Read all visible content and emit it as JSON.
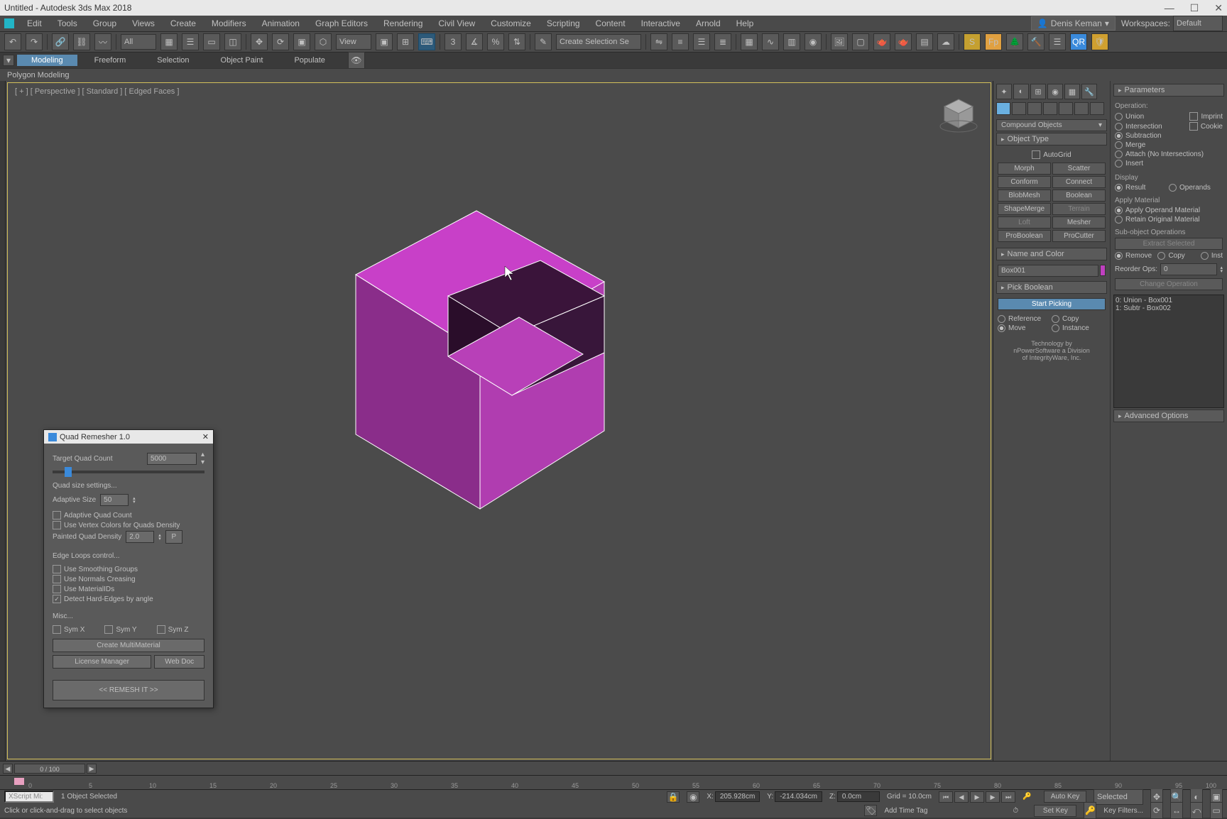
{
  "app": {
    "title": "Untitled - Autodesk 3ds Max 2018"
  },
  "menu": {
    "items": [
      "Edit",
      "Tools",
      "Group",
      "Views",
      "Create",
      "Modifiers",
      "Animation",
      "Graph Editors",
      "Rendering",
      "Civil View",
      "Customize",
      "Scripting",
      "Content",
      "Interactive",
      "Arnold",
      "Help"
    ],
    "user": "Denis Keman",
    "workspaces_label": "Workspaces:",
    "workspaces_value": "Default"
  },
  "toolbar": {
    "filter": "All",
    "view": "View",
    "selset": "Create Selection Se"
  },
  "ribbon": {
    "tabs": [
      "Modeling",
      "Freeform",
      "Selection",
      "Object Paint",
      "Populate"
    ],
    "strip": "Polygon Modeling"
  },
  "viewport": {
    "label": "[ + ] [ Perspective ] [ Standard ] [ Edged Faces ]"
  },
  "cmd": {
    "dropdown": "Compound Objects",
    "rollouts": {
      "objtype": {
        "title": "Object Type",
        "autogrid": "AutoGrid",
        "buttons": [
          [
            "Morph",
            "Scatter"
          ],
          [
            "Conform",
            "Connect"
          ],
          [
            "BlobMesh",
            "Boolean"
          ],
          [
            "ShapeMerge",
            "Terrain"
          ],
          [
            "Loft",
            "Mesher"
          ],
          [
            "ProBoolean",
            "ProCutter"
          ]
        ]
      },
      "namecolor": {
        "title": "Name and Color",
        "name": "Box001"
      },
      "pick": {
        "title": "Pick Boolean",
        "start": "Start Picking",
        "r1": [
          "Reference",
          "Copy"
        ],
        "r2": [
          "Move",
          "Instance"
        ],
        "tech": "Technology by\nnPowerSoftware a Division\nof IntegrityWare, Inc."
      },
      "params": {
        "title": "Parameters",
        "operation": "Operation:",
        "ops": [
          [
            "Union",
            "Imprint"
          ],
          [
            "Intersection",
            "Cookie"
          ],
          [
            "Subtraction",
            ""
          ],
          [
            "Merge",
            ""
          ],
          [
            "Attach (No Intersections)",
            ""
          ],
          [
            "Insert",
            ""
          ]
        ],
        "display": "Display",
        "d1": [
          "Result",
          "Operands"
        ],
        "apply": "Apply Material",
        "am": [
          "Apply Operand Material",
          "Retain Original Material"
        ],
        "subop": "Sub-object Operations",
        "extract": "Extract Selected",
        "re": [
          "Remove",
          "Copy",
          "Inst"
        ],
        "reorder": "Reorder Ops:",
        "reorder_val": "0",
        "change": "Change Operation",
        "list": [
          "0: Union - Box001",
          "1: Subtr - Box002"
        ],
        "advanced": "Advanced Options"
      }
    }
  },
  "floater": {
    "title": "Quad Remesher 1.0",
    "target_label": "Target Quad Count",
    "target_val": "5000",
    "qsize": "Quad size settings...",
    "adaptive_label": "Adaptive Size",
    "adaptive_val": "50",
    "checks1": [
      "Adaptive Quad Count",
      "Use Vertex Colors for Quads Density"
    ],
    "pqd_label": "Painted Quad Density",
    "pqd_val": "2.0",
    "p_btn": "P",
    "edge": "Edge Loops control...",
    "checks2": [
      "Use Smoothing Groups",
      "Use Normals Creasing",
      "Use MaterialIDs",
      "Detect Hard-Edges by angle"
    ],
    "misc": "Misc...",
    "syms": [
      "Sym X",
      "Sym Y",
      "Sym Z"
    ],
    "multi": "Create MultiMaterial",
    "lic": "License Manager",
    "web": "Web Doc",
    "remesh": "<<   REMESH IT   >>"
  },
  "time": {
    "scrub": "0 / 100"
  },
  "status": {
    "sel": "1 Object Selected",
    "hint": "Click or click-and-drag to select objects",
    "script": "XScript Mi:",
    "x": "X:",
    "xv": "205.928cm",
    "y": "Y:",
    "yv": "-214.034cm",
    "z": "Z:",
    "zv": "0.0cm",
    "grid": "Grid = 10.0cm",
    "addtag": "Add Time Tag",
    "autokey": "Auto Key",
    "setkey": "Set Key",
    "sel2": "Selected",
    "keyf": "Key Filters..."
  }
}
